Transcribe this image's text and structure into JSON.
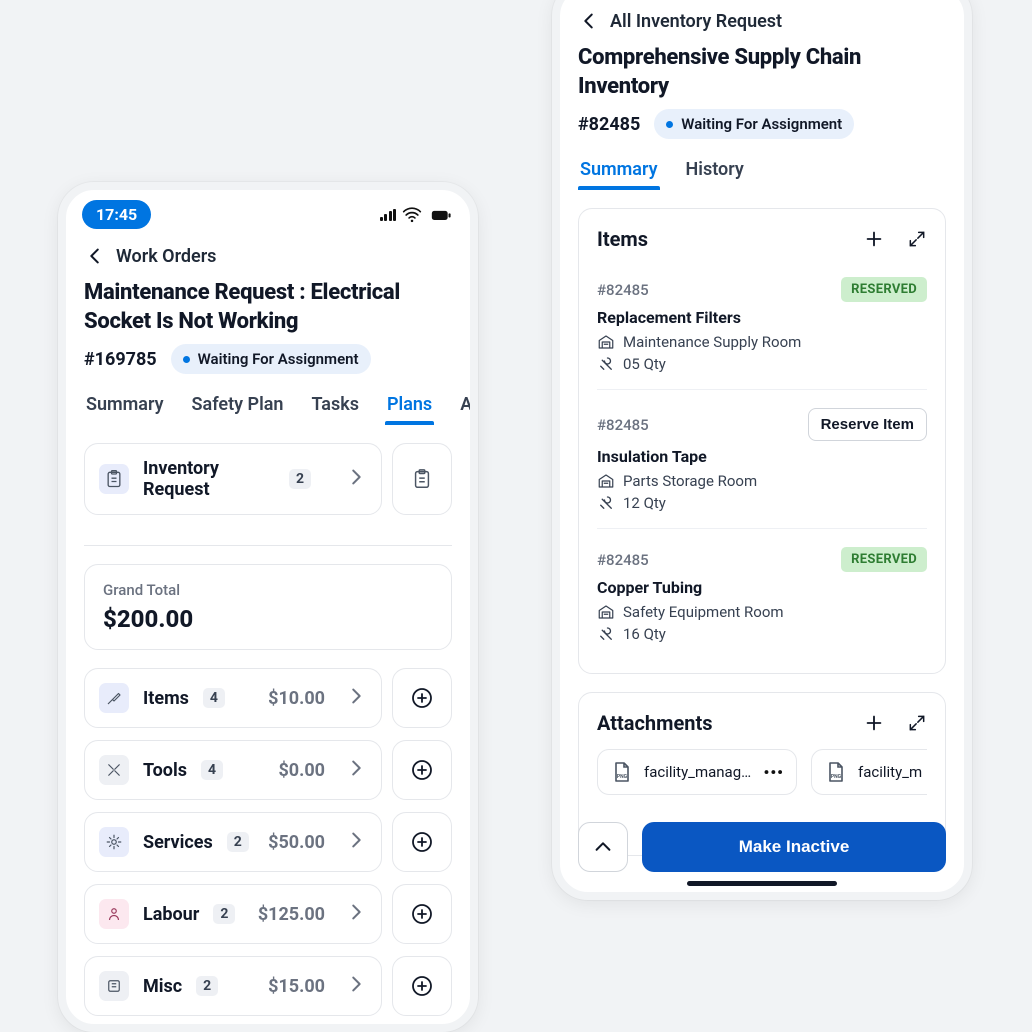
{
  "left": {
    "statusbar": {
      "time": "17:45"
    },
    "back_label": "Work Orders",
    "title": "Maintenance Request : Electrical Socket Is Not Working",
    "id": "#169785",
    "status": "Waiting For Assignment",
    "tabs": [
      "Summary",
      "Safety Plan",
      "Tasks",
      "Plans",
      "Actu"
    ],
    "active_tab": 3,
    "inventory": {
      "label": "Inventory Request",
      "count": "2"
    },
    "total": {
      "label": "Grand Total",
      "amount": "$200.00"
    },
    "rows": [
      {
        "label": "Items",
        "count": "4",
        "price": "$10.00",
        "icon": "screwdriver",
        "box": "indigo"
      },
      {
        "label": "Tools",
        "count": "4",
        "price": "$0.00",
        "icon": "tools",
        "box": "gray"
      },
      {
        "label": "Services",
        "count": "2",
        "price": "$50.00",
        "icon": "services",
        "box": "indigo"
      },
      {
        "label": "Labour",
        "count": "2",
        "price": "$125.00",
        "icon": "labour",
        "box": "pink"
      },
      {
        "label": "Misc",
        "count": "2",
        "price": "$15.00",
        "icon": "misc",
        "box": "gray"
      }
    ]
  },
  "right": {
    "back_label": "All Inventory Request",
    "title": "Comprehensive Supply Chain Inventory",
    "id": "#82485",
    "status": "Waiting For Assignment",
    "tabs": [
      "Summary",
      "History"
    ],
    "active_tab": 0,
    "items_section": {
      "title": "Items",
      "items": [
        {
          "id": "#82485",
          "name": "Replacement Filters",
          "location": "Maintenance Supply Room",
          "qty": "05 Qty",
          "state": "RESERVED"
        },
        {
          "id": "#82485",
          "name": "Insulation Tape",
          "location": "Parts Storage Room",
          "qty": "12 Qty",
          "action": "Reserve Item"
        },
        {
          "id": "#82485",
          "name": "Copper Tubing",
          "location": "Safety Equipment Room",
          "qty": "16 Qty",
          "state": "RESERVED"
        }
      ]
    },
    "attachments": {
      "title": "Attachments",
      "files": [
        {
          "name": "facility_manage…"
        },
        {
          "name": "facility_m"
        }
      ]
    },
    "primary_action": "Make Inactive"
  }
}
